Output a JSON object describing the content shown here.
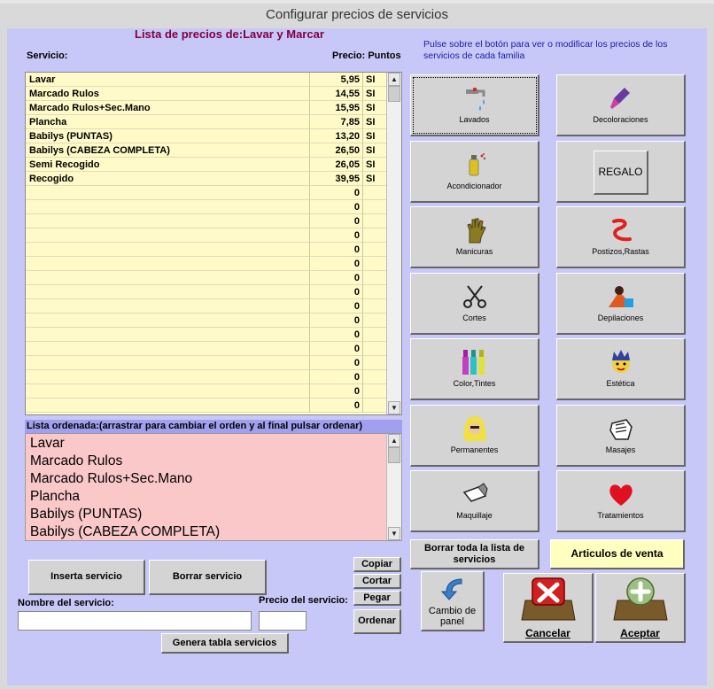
{
  "window": {
    "title": "Configurar precios de servicios"
  },
  "list_title": "Lista de precios de:Lavar y Marcar",
  "columns": {
    "servicio": "Servicio:",
    "precio_puntos": "Precio: Puntos"
  },
  "help_text": "Pulse sobre el botón para ver o modificar los precios de los servicios de cada familia",
  "services": [
    {
      "name": "Lavar",
      "price": "5,95",
      "points": "SI"
    },
    {
      "name": "Marcado Rulos",
      "price": "14,55",
      "points": "SI"
    },
    {
      "name": "Marcado Rulos+Sec.Mano",
      "price": "15,95",
      "points": "SI"
    },
    {
      "name": "Plancha",
      "price": "7,85",
      "points": "SI"
    },
    {
      "name": "Babilys (PUNTAS)",
      "price": "13,20",
      "points": "SI"
    },
    {
      "name": "Babilys (CABEZA COMPLETA)",
      "price": "26,50",
      "points": "SI"
    },
    {
      "name": "Semi Recogido",
      "price": "26,05",
      "points": "SI"
    },
    {
      "name": "Recogido",
      "price": "39,95",
      "points": "SI"
    },
    {
      "name": "",
      "price": "0",
      "points": ""
    },
    {
      "name": "",
      "price": "0",
      "points": ""
    },
    {
      "name": "",
      "price": "0",
      "points": ""
    },
    {
      "name": "",
      "price": "0",
      "points": ""
    },
    {
      "name": "",
      "price": "0",
      "points": ""
    },
    {
      "name": "",
      "price": "0",
      "points": ""
    },
    {
      "name": "",
      "price": "0",
      "points": ""
    },
    {
      "name": "",
      "price": "0",
      "points": ""
    },
    {
      "name": "",
      "price": "0",
      "points": ""
    },
    {
      "name": "",
      "price": "0",
      "points": ""
    },
    {
      "name": "",
      "price": "0",
      "points": ""
    },
    {
      "name": "",
      "price": "0",
      "points": ""
    },
    {
      "name": "",
      "price": "0",
      "points": ""
    },
    {
      "name": "",
      "price": "0",
      "points": ""
    },
    {
      "name": "",
      "price": "0",
      "points": ""
    },
    {
      "name": "",
      "price": "0",
      "points": ""
    }
  ],
  "ordered_label": "Lista ordenada:(arrastrar para cambiar el orden y al final pulsar ordenar)",
  "ordered_list": [
    "Lavar",
    "Marcado Rulos",
    "Marcado Rulos+Sec.Mano",
    "Plancha",
    "Babilys (PUNTAS)",
    "Babilys (CABEZA COMPLETA)"
  ],
  "families": [
    {
      "label": "Lavados",
      "icon": "faucet-icon"
    },
    {
      "label": "Decoloraciones",
      "icon": "paintbrush-icon"
    },
    {
      "label": "Acondicionador",
      "icon": "spray-can-icon"
    },
    {
      "label": "REGALO",
      "icon": ""
    },
    {
      "label": "Manicuras",
      "icon": "hand-icon"
    },
    {
      "label": "Postizos,Rastas",
      "icon": "hair-curl-icon"
    },
    {
      "label": "Cortes",
      "icon": "scissors-icon"
    },
    {
      "label": "Depilaciones",
      "icon": "depilation-icon"
    },
    {
      "label": "Color,Tintes",
      "icon": "dye-bottles-icon"
    },
    {
      "label": "Estética",
      "icon": "face-icon"
    },
    {
      "label": "Permanentes",
      "icon": "blonde-hair-icon"
    },
    {
      "label": "Masajes",
      "icon": "massage-hand-icon"
    },
    {
      "label": "Maquillaje",
      "icon": "makeup-icon"
    },
    {
      "label": "Tratamientos",
      "icon": "heart-icon"
    }
  ],
  "buttons": {
    "borrar_lista": "Borrar toda la lista de servicios",
    "articulos": "Articulos de venta",
    "cambio_panel": "Cambio de panel",
    "cancelar": "Cancelar",
    "aceptar": "Aceptar",
    "inserta": "Inserta servicio",
    "borrar": "Borrar servicio",
    "copiar": "Copiar",
    "cortar": "Cortar",
    "pegar": "Pegar",
    "ordenar": "Ordenar",
    "genera": "Genera tabla servicios"
  },
  "form": {
    "nombre_label": "Nombre del servicio:",
    "precio_label": "Precio del servicio:",
    "nombre_value": "",
    "precio_value": ""
  },
  "colors": {
    "panel_bg": "#c8c8f8",
    "grid_bg": "#fffac8",
    "list_bg": "#fac8c8",
    "title": "#800040"
  }
}
